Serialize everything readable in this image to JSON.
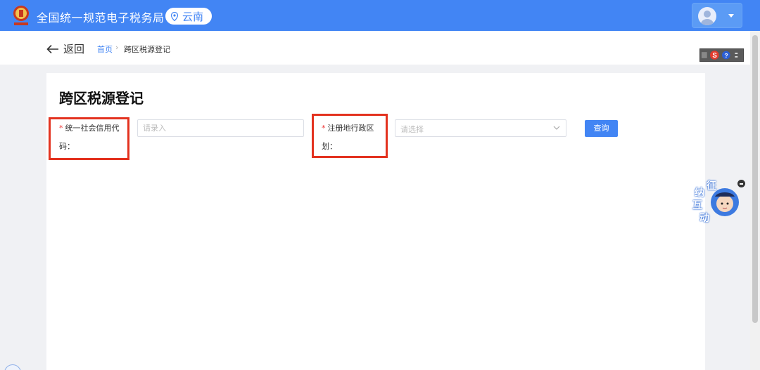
{
  "header": {
    "site_title": "全国统一规范电子税务局",
    "region": "云南"
  },
  "breadcrumb": {
    "back_label": "返回",
    "home": "首页",
    "separator": "›",
    "current": "跨区税源登记"
  },
  "main": {
    "page_title": "跨区税源登记",
    "fields": {
      "credit_code": {
        "required_mark": "*",
        "label_line1": "统一社会信用代",
        "label_line2": "码：",
        "placeholder": "请录入",
        "value": ""
      },
      "region": {
        "required_mark": "*",
        "label_line1": "注册地行政区",
        "label_line2": "划：",
        "placeholder": "请选择",
        "value": ""
      }
    },
    "query_button": "查询"
  },
  "assistant": {
    "chars": [
      "征",
      "纳",
      "互",
      "动"
    ]
  },
  "icons": {
    "logo": "tax-emblem-icon",
    "region": "location-pin-icon",
    "avatar": "user-avatar-icon",
    "back": "arrow-left-icon",
    "select": "chevron-down-icon"
  },
  "colors": {
    "primary": "#4285f4",
    "highlight_box": "#e3321f",
    "required": "#ee3333"
  }
}
